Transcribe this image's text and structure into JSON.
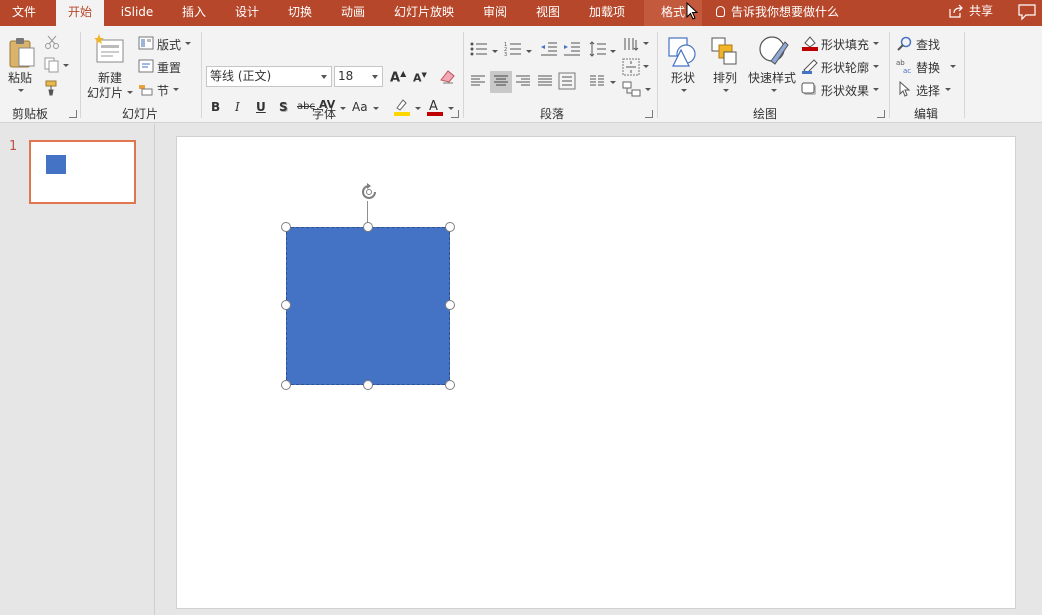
{
  "tabs": [
    {
      "label": "文件"
    },
    {
      "label": "开始"
    },
    {
      "label": "iSlide"
    },
    {
      "label": "插入"
    },
    {
      "label": "设计"
    },
    {
      "label": "切换"
    },
    {
      "label": "动画"
    },
    {
      "label": "幻灯片放映"
    },
    {
      "label": "审阅"
    },
    {
      "label": "视图"
    },
    {
      "label": "加载项"
    },
    {
      "label": "格式"
    }
  ],
  "tell_me": "告诉我你想要做什么",
  "share": "共享",
  "clipboard": {
    "paste": "粘贴",
    "group": "剪贴板"
  },
  "slides": {
    "new_line1": "新建",
    "new_line2": "幻灯片",
    "layout": "版式",
    "reset": "重置",
    "section": "节",
    "group": "幻灯片"
  },
  "font": {
    "name": "等线 (正文)",
    "size": "18",
    "bold": "B",
    "italic": "I",
    "underline": "U",
    "shadow": "S",
    "strike": "abc",
    "spacing": "AV",
    "case": "Aa",
    "grow": "A",
    "shrink": "A",
    "group": "字体"
  },
  "paragraph": {
    "group": "段落"
  },
  "drawing": {
    "shapes": "形状",
    "arrange": "排列",
    "quick_styles": "快速样式",
    "fill": "形状填充",
    "outline": "形状轮廓",
    "effects": "形状效果",
    "group": "绘图"
  },
  "editing": {
    "find": "查找",
    "replace": "替换",
    "select": "选择",
    "group": "编辑"
  },
  "thumbnail": {
    "number": "1"
  },
  "colors": {
    "accent": "#b7472a",
    "shape": "#4472c4",
    "thumb_border": "#e07650",
    "font_color": "#c00000",
    "highlight": "#ffd600"
  }
}
